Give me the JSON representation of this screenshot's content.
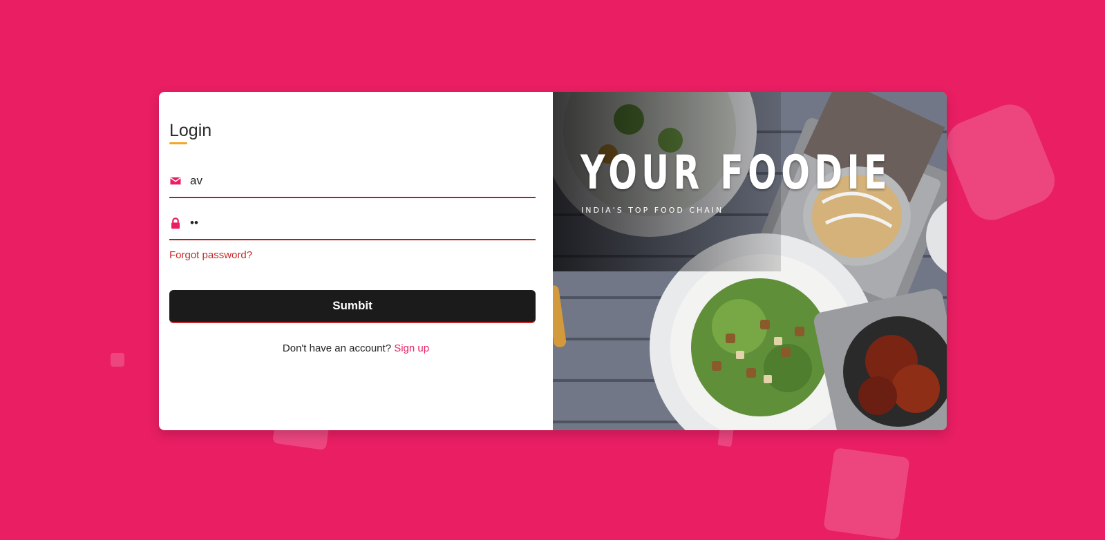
{
  "colors": {
    "background": "#e91e63",
    "accent": "#e91e63",
    "error_red": "#c62828",
    "title_underline": "#f5a623",
    "button": "#1b1b1b"
  },
  "login": {
    "title": "Login",
    "email_field": {
      "value": "av",
      "icon": "envelope-icon"
    },
    "password_field": {
      "value": "ab",
      "icon": "lock-icon"
    },
    "forgot_label": "Forgot password?",
    "submit_label": "Sumbit",
    "signup_prompt": "Don't have an account?",
    "signup_link": "Sign up"
  },
  "hero": {
    "brand": "YOUR FOODIE",
    "tagline": "INDIA'S TOP FOOD CHAIN"
  }
}
